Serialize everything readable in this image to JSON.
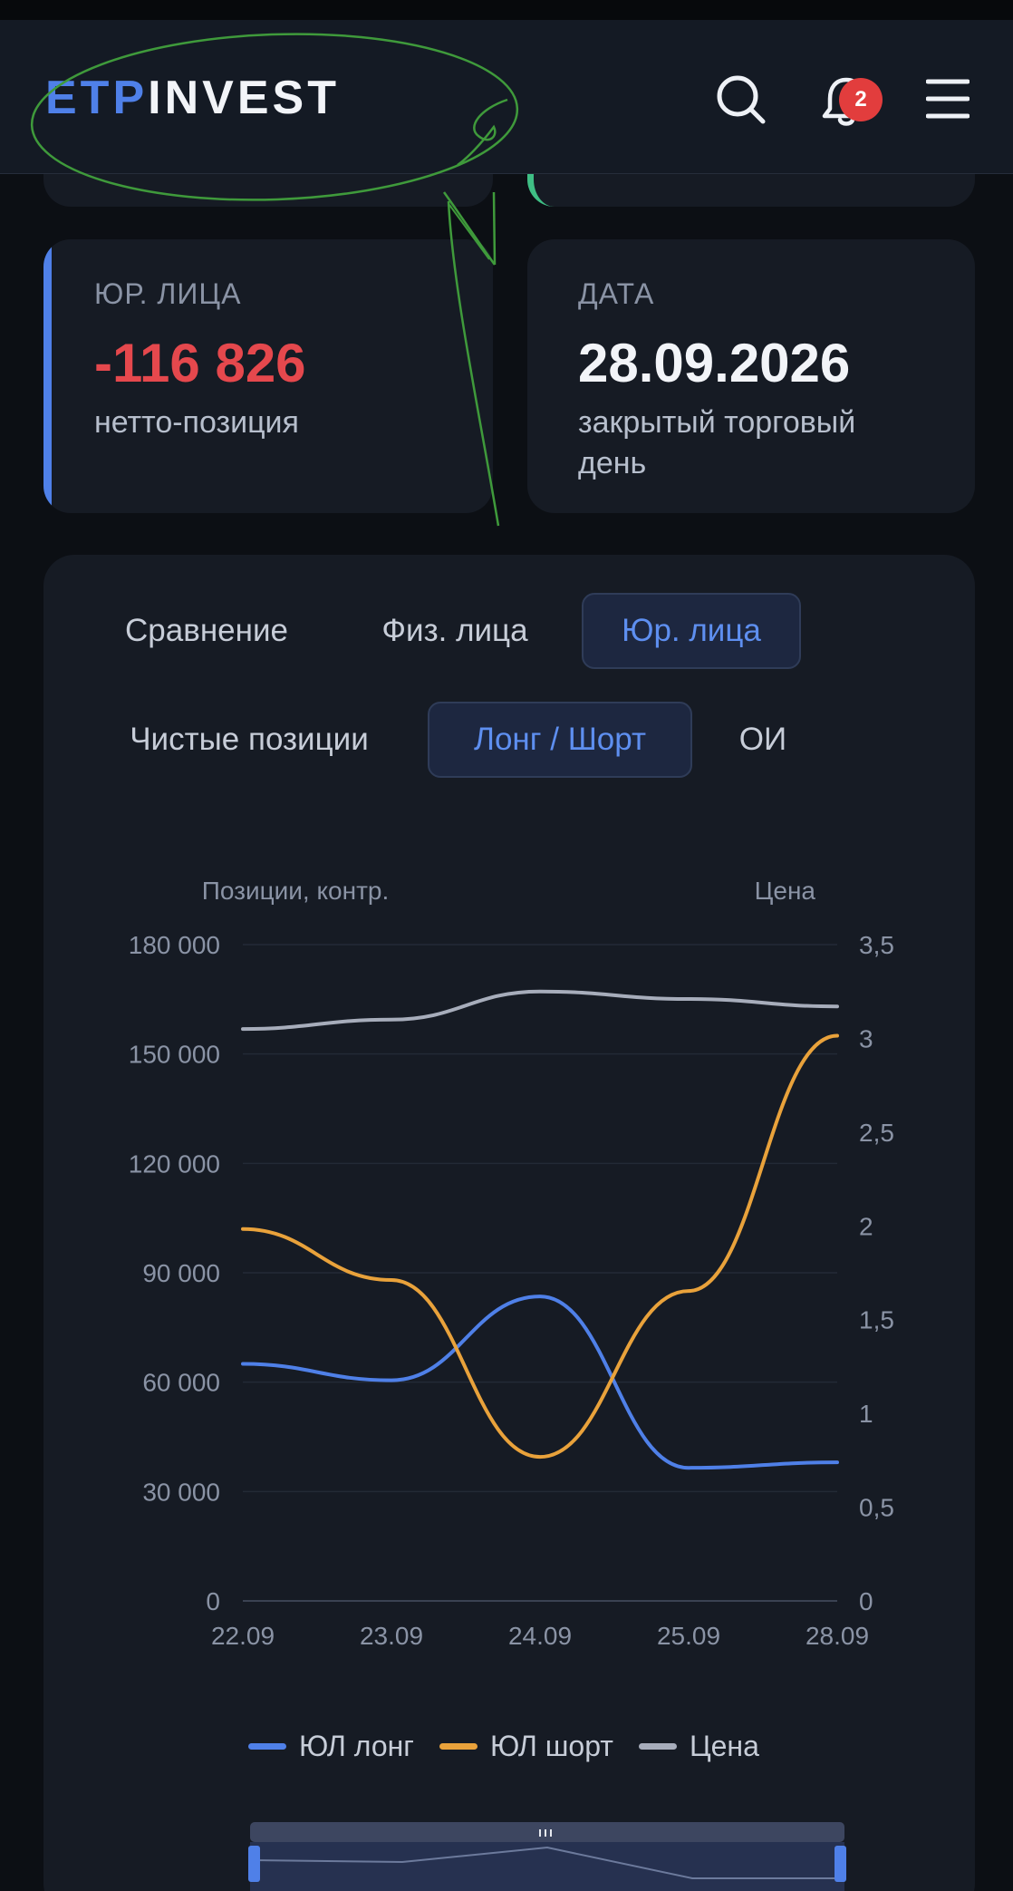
{
  "header": {
    "logo_part1": "ETP",
    "logo_part2": "INVEST",
    "notification_count": "2",
    "icons": [
      "search-icon",
      "bell-icon",
      "menu-icon"
    ]
  },
  "cards": [
    {
      "label": "ЮР. ЛИЦА",
      "value": "-116 826",
      "sub": "нетто-позиция",
      "value_color": "#e5484d"
    },
    {
      "label": "ДАТА",
      "value": "28.09.2026",
      "sub": "закрытый торговый день",
      "value_color": "#f2f4f8"
    }
  ],
  "tabs_group1": [
    "Сравнение",
    "Физ. лица",
    "Юр. лица"
  ],
  "tabs_group1_active": "Юр. лица",
  "tabs_group2": [
    "Чистые позиции",
    "Лонг / Шорт",
    "ОИ"
  ],
  "tabs_group2_active": "Лонг / Шорт",
  "colors": {
    "accent": "#4f80e8",
    "long": "#4f80e8",
    "short": "#e9a23b",
    "price": "#a7adbb",
    "negative": "#e5484d"
  },
  "chart_data": {
    "type": "line",
    "ylabel_left": "Позиции, контр.",
    "ylabel_right": "Цена",
    "categories": [
      "22.09",
      "23.09",
      "24.09",
      "25.09",
      "28.09"
    ],
    "y_left_ticks": [
      "0",
      "30 000",
      "60 000",
      "90 000",
      "120 000",
      "150 000",
      "180 000"
    ],
    "y_right_ticks": [
      "0",
      "0,5",
      "1",
      "1,5",
      "2",
      "2,5",
      "3",
      "3,5"
    ],
    "ylim_left": [
      0,
      180000
    ],
    "ylim_right": [
      0,
      3.5
    ],
    "grid": true,
    "legend_position": "bottom",
    "series": [
      {
        "name": "ЮЛ лонг",
        "axis": "left",
        "values": [
          65000,
          60500,
          83500,
          36500,
          38000
        ]
      },
      {
        "name": "ЮЛ шорт",
        "axis": "left",
        "values": [
          102000,
          88000,
          39500,
          85000,
          155000
        ]
      },
      {
        "name": "Цена",
        "axis": "right",
        "values": [
          3.05,
          3.1,
          3.25,
          3.21,
          3.17
        ]
      }
    ]
  }
}
